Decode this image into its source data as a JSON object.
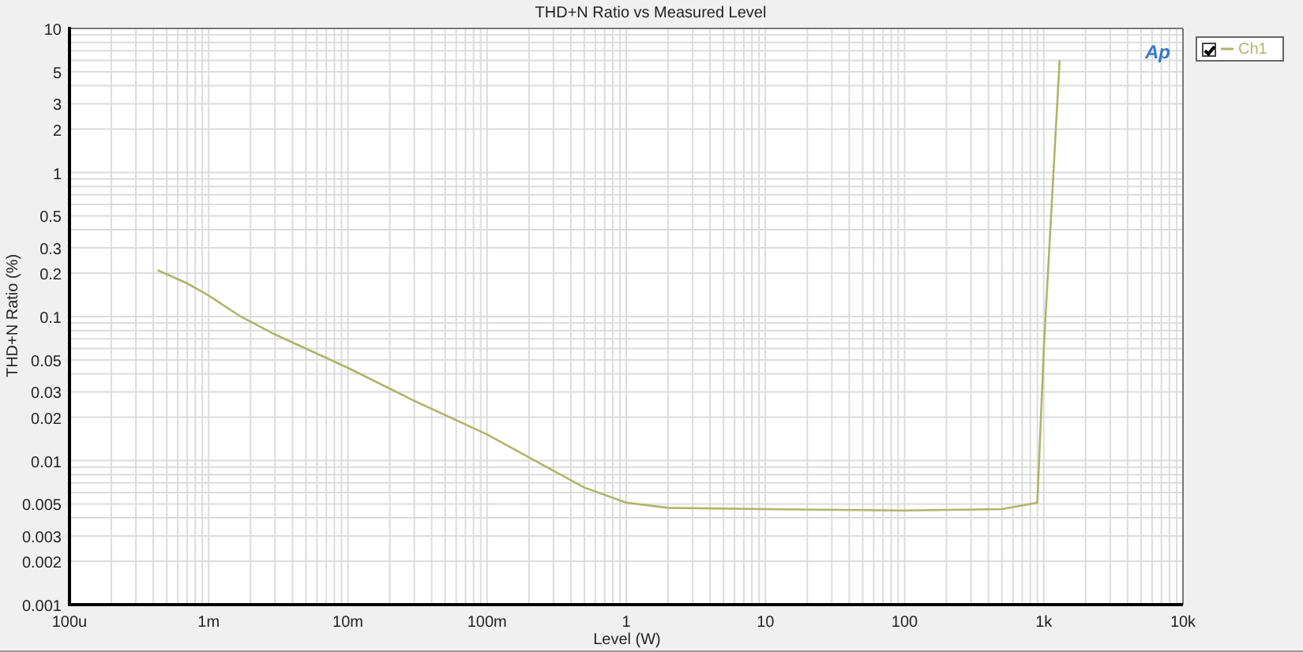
{
  "graph": {
    "title": "THD+N Ratio vs Measured Level",
    "xlabel": "Level (W)",
    "ylabel": "THD+N Ratio (%)",
    "x_axis_labels": [
      "100u",
      "1m",
      "10m",
      "100m",
      "1",
      "10",
      "100",
      "1k",
      "10k"
    ],
    "y_axis_labels": [
      "10",
      "5",
      "3",
      "2",
      "1",
      "0.5",
      "0.3",
      "0.2",
      "0.1",
      "0.05",
      "0.03",
      "0.02",
      "0.01",
      "0.005",
      "0.003",
      "0.002",
      "0.001"
    ],
    "logo": "Ap"
  },
  "legend": {
    "checked": true,
    "label": "Ch1",
    "color": "#b0b46a"
  }
}
